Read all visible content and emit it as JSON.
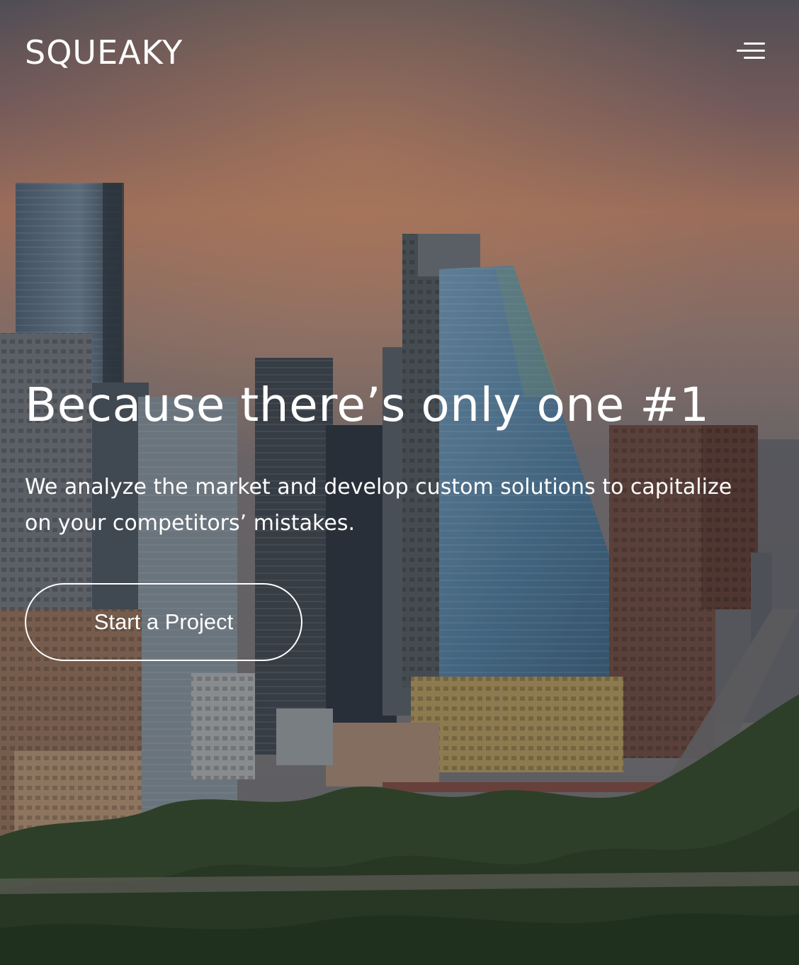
{
  "header": {
    "logo": "SQUEAKY",
    "menu_icon": "hamburger-menu-icon"
  },
  "hero": {
    "headline": "Because there’s only one #1",
    "subheading": "We analyze the market and develop custom solutions to capitalize on your competitors’ mistakes.",
    "cta_label": "Start a Project",
    "background": "city-skyline-photo"
  },
  "colors": {
    "text": "#ffffff",
    "sky_top": "#6b5f66",
    "sky_glow": "#c98a6a",
    "tower_glass": "#5f86a8",
    "trees": "#2f4a2c"
  }
}
